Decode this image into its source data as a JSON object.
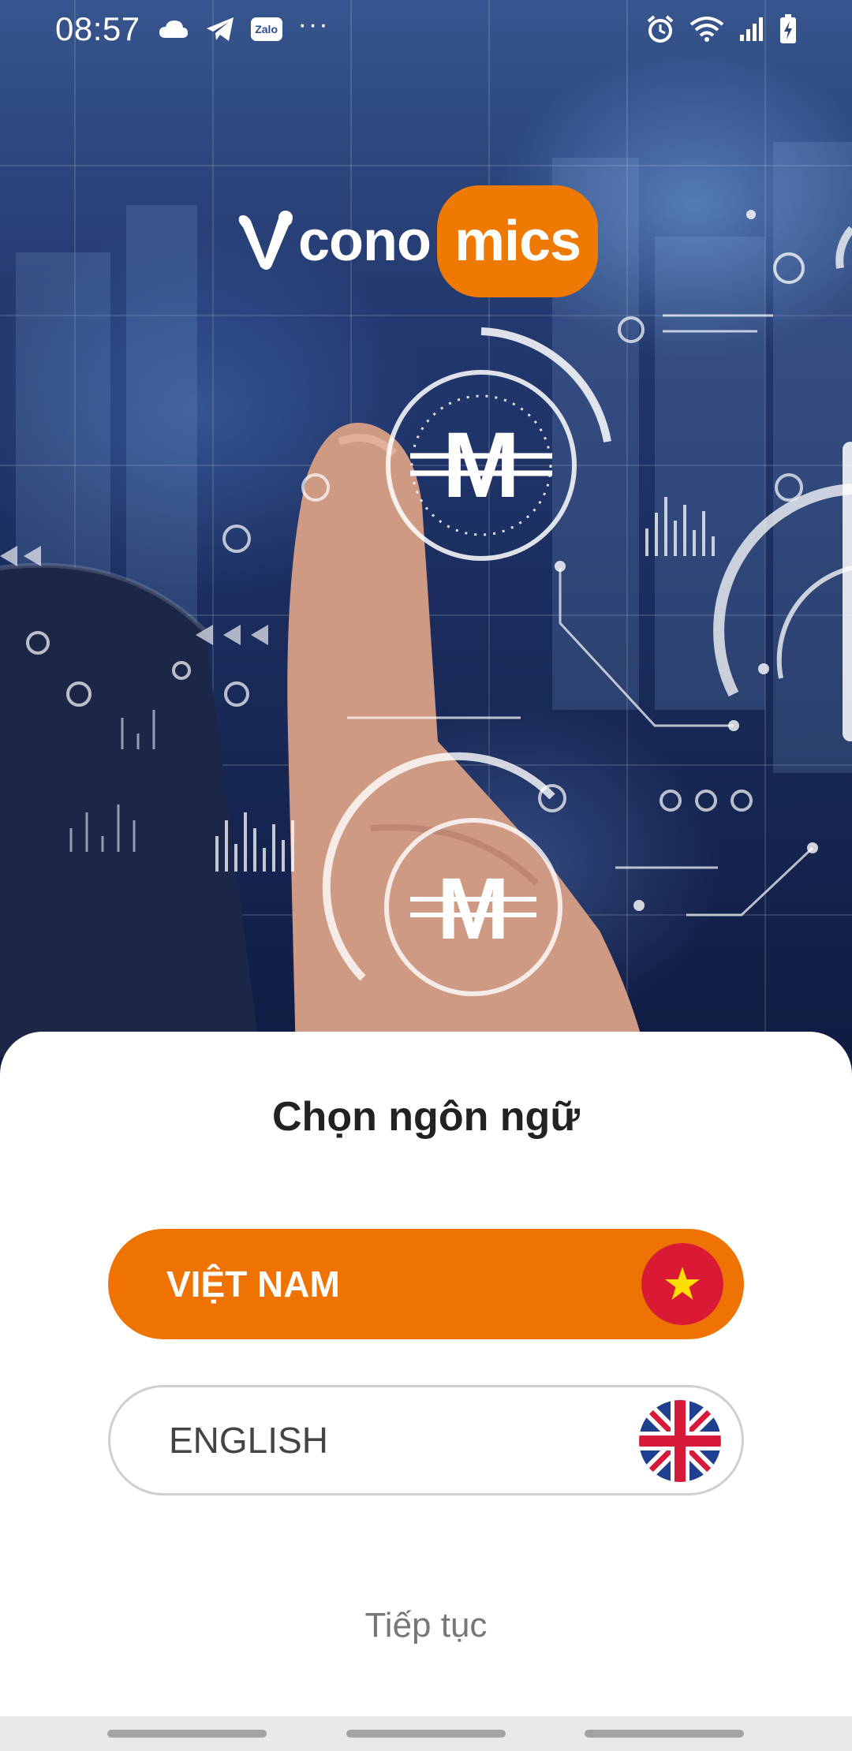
{
  "status_bar": {
    "time": "08:57",
    "left_icons": [
      "cloud-icon",
      "telegram-icon",
      "zalo-icon",
      "more-dots-icon"
    ],
    "zalo_label": "Zalo",
    "dots": "···",
    "right_icons": [
      "alarm-icon",
      "wifi-icon",
      "signal-icon",
      "battery-charging-icon"
    ]
  },
  "logo": {
    "text_left": "cono",
    "text_right": "mics",
    "accent": "#ee7a03"
  },
  "language_sheet": {
    "title": "Chọn ngôn ngữ",
    "options": [
      {
        "label": "VIỆT NAM",
        "flag": "vietnam-flag-icon",
        "selected": true
      },
      {
        "label": "ENGLISH",
        "flag": "uk-flag-icon",
        "selected": false
      }
    ],
    "continue_label": "Tiếp tục"
  },
  "colors": {
    "accent_orange": "#ee7303",
    "sheet_background": "#ffffff",
    "title_text": "#222222",
    "continue_text": "#777777"
  }
}
